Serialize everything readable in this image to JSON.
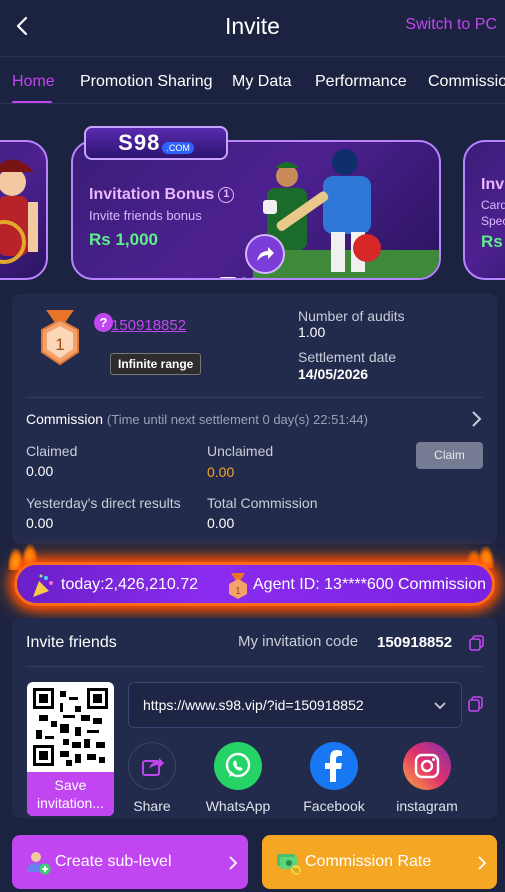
{
  "header": {
    "title": "Invite",
    "switch_label": "Switch to PC"
  },
  "tabs": [
    {
      "label": "Home"
    },
    {
      "label": "Promotion Sharing"
    },
    {
      "label": "My Data"
    },
    {
      "label": "Performance"
    },
    {
      "label": "Commission"
    }
  ],
  "banner": {
    "logo": "S98",
    "logo_suffix": ".COM",
    "main": {
      "title": "Invitation Bonus",
      "subtitle": "Invite friends bonus",
      "amount": "Rs 1,000"
    },
    "right": {
      "title": "Invi",
      "line1": "Card",
      "line2": "Spec",
      "amount": "Rs"
    }
  },
  "account": {
    "level": "1",
    "id": "150918852",
    "range_badge": "Infinite range",
    "audits_label": "Number of audits",
    "audits_value": "1.00",
    "settlement_label": "Settlement date",
    "settlement_value": "14/05/2026"
  },
  "commission": {
    "title": "Commission",
    "note": "(Time until next settlement 0 day(s) 22:51:44)",
    "claimed_label": "Claimed",
    "claimed_value": "0.00",
    "unclaimed_label": "Unclaimed",
    "unclaimed_value": "0.00",
    "claim_button": "Claim",
    "yesterday_label": "Yesterday's direct results",
    "yesterday_value": "0.00",
    "total_label": "Total Commission",
    "total_value": "0.00"
  },
  "marquee": {
    "today_text": "today:",
    "today_value": "2,426,210.72",
    "agent_text": "Agent ID: 13****600 Commission"
  },
  "invite": {
    "title": "Invite friends",
    "code_label": "My invitation code",
    "code": "150918852",
    "url": "https://www.s98.vip/?id=150918852",
    "qr_save": "Save invitation..."
  },
  "share": [
    {
      "label": "Share",
      "color": "#232b4d",
      "icon": "share-icon"
    },
    {
      "label": "WhatsApp",
      "color": "#25d366",
      "icon": "whatsapp-icon"
    },
    {
      "label": "Facebook",
      "color": "#1877f2",
      "icon": "facebook-icon"
    },
    {
      "label": "instagram",
      "color": "#e1306c",
      "icon": "instagram-icon"
    }
  ],
  "buttons": {
    "create_sub": "Create sub-level",
    "commission_rate": "Commission Rate"
  },
  "colors": {
    "accent": "#c146f2",
    "background": "#1c2340",
    "panel": "#232b4d",
    "orange": "#f5a623"
  }
}
